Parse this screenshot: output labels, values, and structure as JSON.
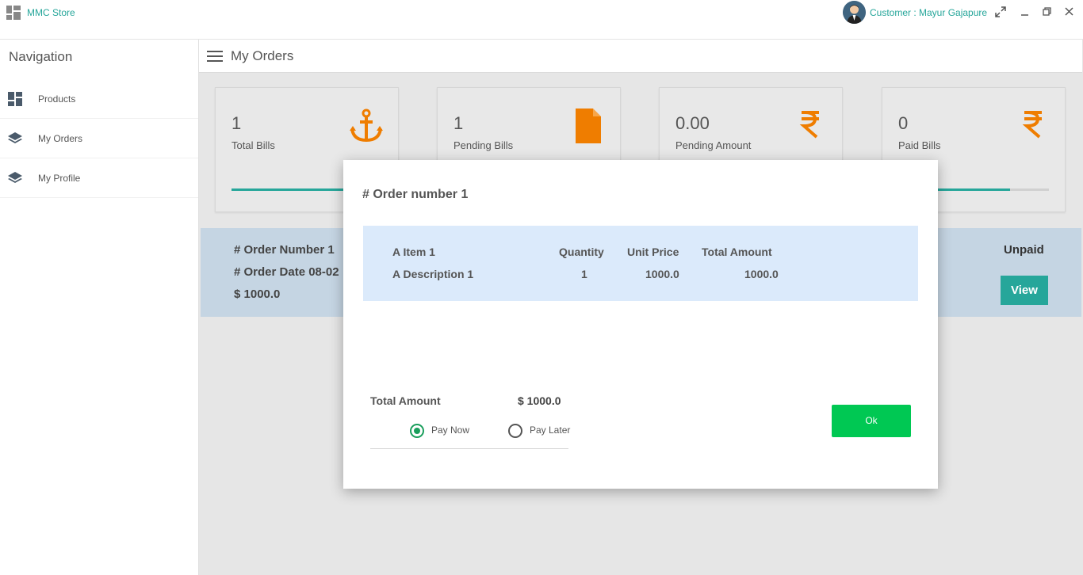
{
  "app": {
    "title": "MMC Store",
    "customer": "Customer : Mayur Gajapure"
  },
  "sidebar": {
    "title": "Navigation",
    "items": [
      {
        "label": "Products",
        "icon": "dashboard-grid-icon"
      },
      {
        "label": "My Orders",
        "icon": "layers-icon"
      },
      {
        "label": "My Profile",
        "icon": "layers-icon"
      }
    ]
  },
  "header": {
    "title": "My Orders"
  },
  "stats": [
    {
      "value": "1",
      "label": "Total Bills",
      "icon": "anchor-icon",
      "progress": 0.74
    },
    {
      "value": "1",
      "label": "Pending Bills",
      "icon": "document-icon",
      "progress": 0.5
    },
    {
      "value": "0.00",
      "label": "Pending Amount",
      "icon": "rupee-icon",
      "progress": 0.5
    },
    {
      "value": "0",
      "label": "Paid Bills",
      "icon": "rupee-icon",
      "progress": 0.74
    }
  ],
  "order": {
    "number": "# Order Number 1",
    "date": "# Order Date 08-02",
    "amount": "$ 1000.0",
    "status": "Unpaid",
    "view_label": "View"
  },
  "modal": {
    "title": "# Order number 1",
    "columns": {
      "item": "A Item 1",
      "quantity": "Quantity",
      "unit_price": "Unit Price",
      "total_amount": "Total Amount"
    },
    "row": {
      "description": "A Description 1",
      "quantity": "1",
      "unit_price": "1000.0",
      "total_amount": "1000.0"
    },
    "total_label": "Total Amount",
    "total_value": "$ 1000.0",
    "pay_now": "Pay Now",
    "pay_later": "Pay Later",
    "ok_label": "Ok"
  },
  "colors": {
    "accent": "#26a69a",
    "icon_orange": "#ef7d00",
    "ok_green": "#00c853",
    "radio_green": "#1a9e5c"
  }
}
